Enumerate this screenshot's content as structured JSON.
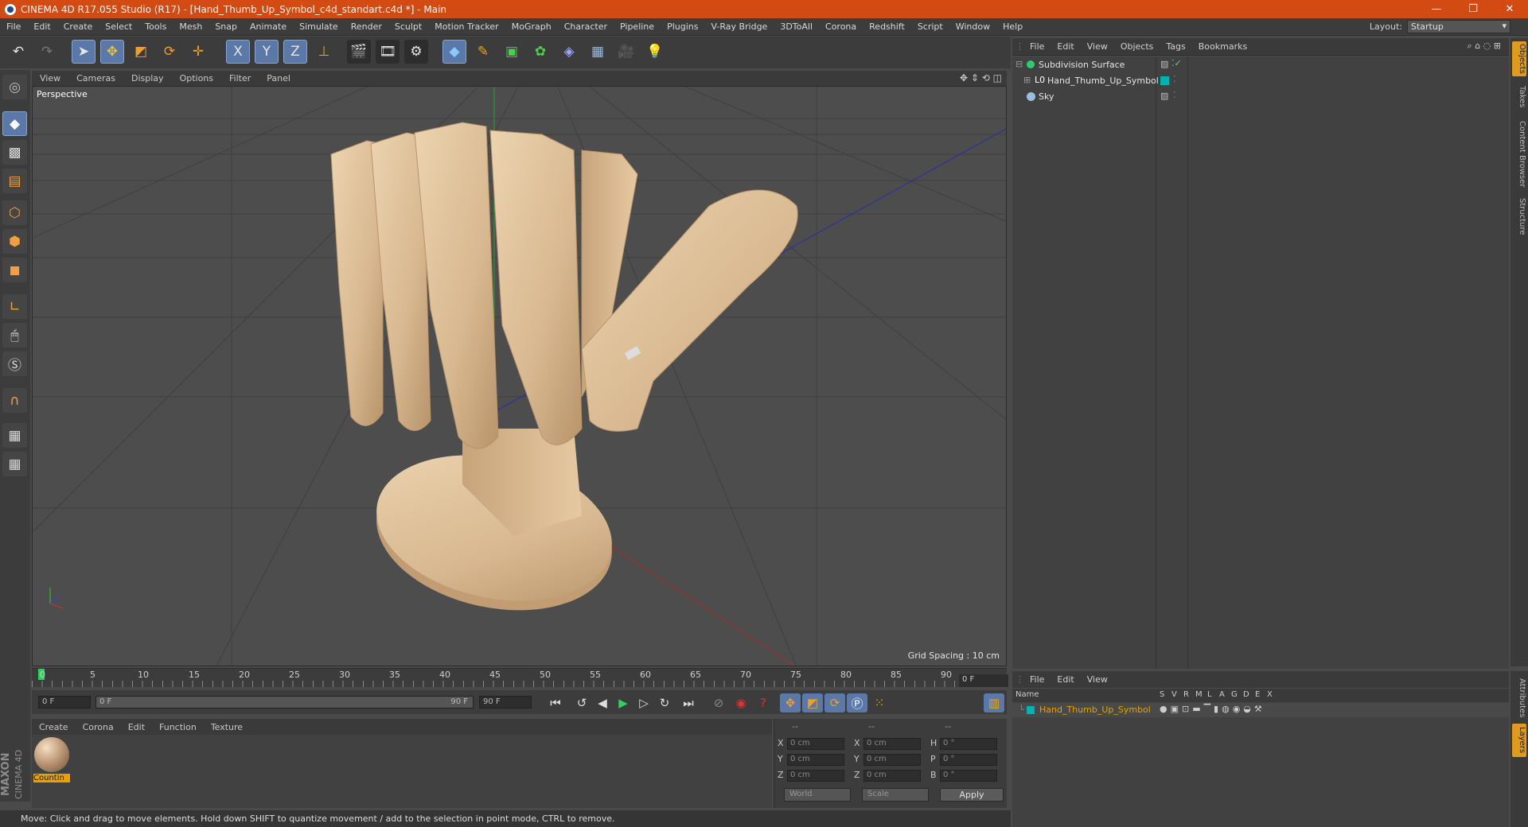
{
  "window": {
    "title": "CINEMA 4D R17.055 Studio (R17) - [Hand_Thumb_Up_Symbol_c4d_standart.c4d *] - Main",
    "buttons": [
      "—",
      "❐",
      "✕"
    ]
  },
  "menu": [
    "File",
    "Edit",
    "Create",
    "Select",
    "Tools",
    "Mesh",
    "Snap",
    "Animate",
    "Simulate",
    "Render",
    "Sculpt",
    "Motion Tracker",
    "MoGraph",
    "Character",
    "Pipeline",
    "Plugins",
    "V-Ray Bridge",
    "3DToAll",
    "Corona",
    "Redshift",
    "Script",
    "Window",
    "Help"
  ],
  "layout": {
    "label": "Layout:",
    "value": "Startup"
  },
  "toolbar": {
    "axis_x": "X",
    "axis_y": "Y",
    "axis_z": "Z"
  },
  "viewport": {
    "menu": [
      "View",
      "Cameras",
      "Display",
      "Options",
      "Filter",
      "Panel"
    ],
    "camera_label": "Perspective",
    "grid_spacing": "Grid Spacing : 10 cm"
  },
  "timeline": {
    "ticks": [
      "0",
      "5",
      "10",
      "15",
      "20",
      "25",
      "30",
      "35",
      "40",
      "45",
      "50",
      "55",
      "60",
      "65",
      "70",
      "75",
      "80",
      "85",
      "90"
    ],
    "current_frame": "0 F",
    "start_field": "0 F",
    "slider_start": "0 F",
    "slider_end": "90 F",
    "end_field": "90 F"
  },
  "material_manager": {
    "menu": [
      "Create",
      "Corona",
      "Edit",
      "Function",
      "Texture"
    ],
    "material_name": "Countin"
  },
  "coordinates": {
    "headers": [
      "--",
      "--",
      "--"
    ],
    "rows": [
      {
        "l1": "X",
        "v1": "0 cm",
        "l2": "X",
        "v2": "0 cm",
        "l3": "H",
        "v3": "0 °"
      },
      {
        "l1": "Y",
        "v1": "0 cm",
        "l2": "Y",
        "v2": "0 cm",
        "l3": "P",
        "v3": "0 °"
      },
      {
        "l1": "Z",
        "v1": "0 cm",
        "l2": "Z",
        "v2": "0 cm",
        "l3": "B",
        "v3": "0 °"
      }
    ],
    "space_dropdown": "World",
    "mode_dropdown": "Scale",
    "apply_label": "Apply"
  },
  "status": "Move: Click and drag to move elements. Hold down SHIFT to quantize movement / add to the selection in point mode, CTRL to remove.",
  "logo": {
    "line1": "MAXON",
    "line2": "CINEMA 4D"
  },
  "object_manager": {
    "menu": [
      "File",
      "Edit",
      "View",
      "Objects",
      "Tags",
      "Bookmarks"
    ],
    "objects": [
      {
        "name": "Subdivision Surface",
        "color": "#2ecc71"
      },
      {
        "name": "Hand_Thumb_Up_Symbol",
        "color": "#ffffff"
      },
      {
        "name": "Sky",
        "color": "#9bbfe0"
      }
    ]
  },
  "right_tabs": [
    "Objects",
    "Takes",
    "Content Browser",
    "Structure"
  ],
  "right_tabs_bottom": [
    "Attributes",
    "Layers"
  ],
  "layer_manager": {
    "menu": [
      "File",
      "Edit",
      "View"
    ],
    "columns": [
      "Name",
      "S",
      "V",
      "R",
      "M",
      "L",
      "A",
      "G",
      "D",
      "E",
      "X"
    ],
    "layer_name": "Hand_Thumb_Up_Symbol",
    "layer_color": "#00b3b3"
  },
  "colors": {
    "titlebar": "#d44a13",
    "accent_selected": "#5a79a8",
    "material_highlight": "#e6a300",
    "layer_name": "#e6a300"
  }
}
